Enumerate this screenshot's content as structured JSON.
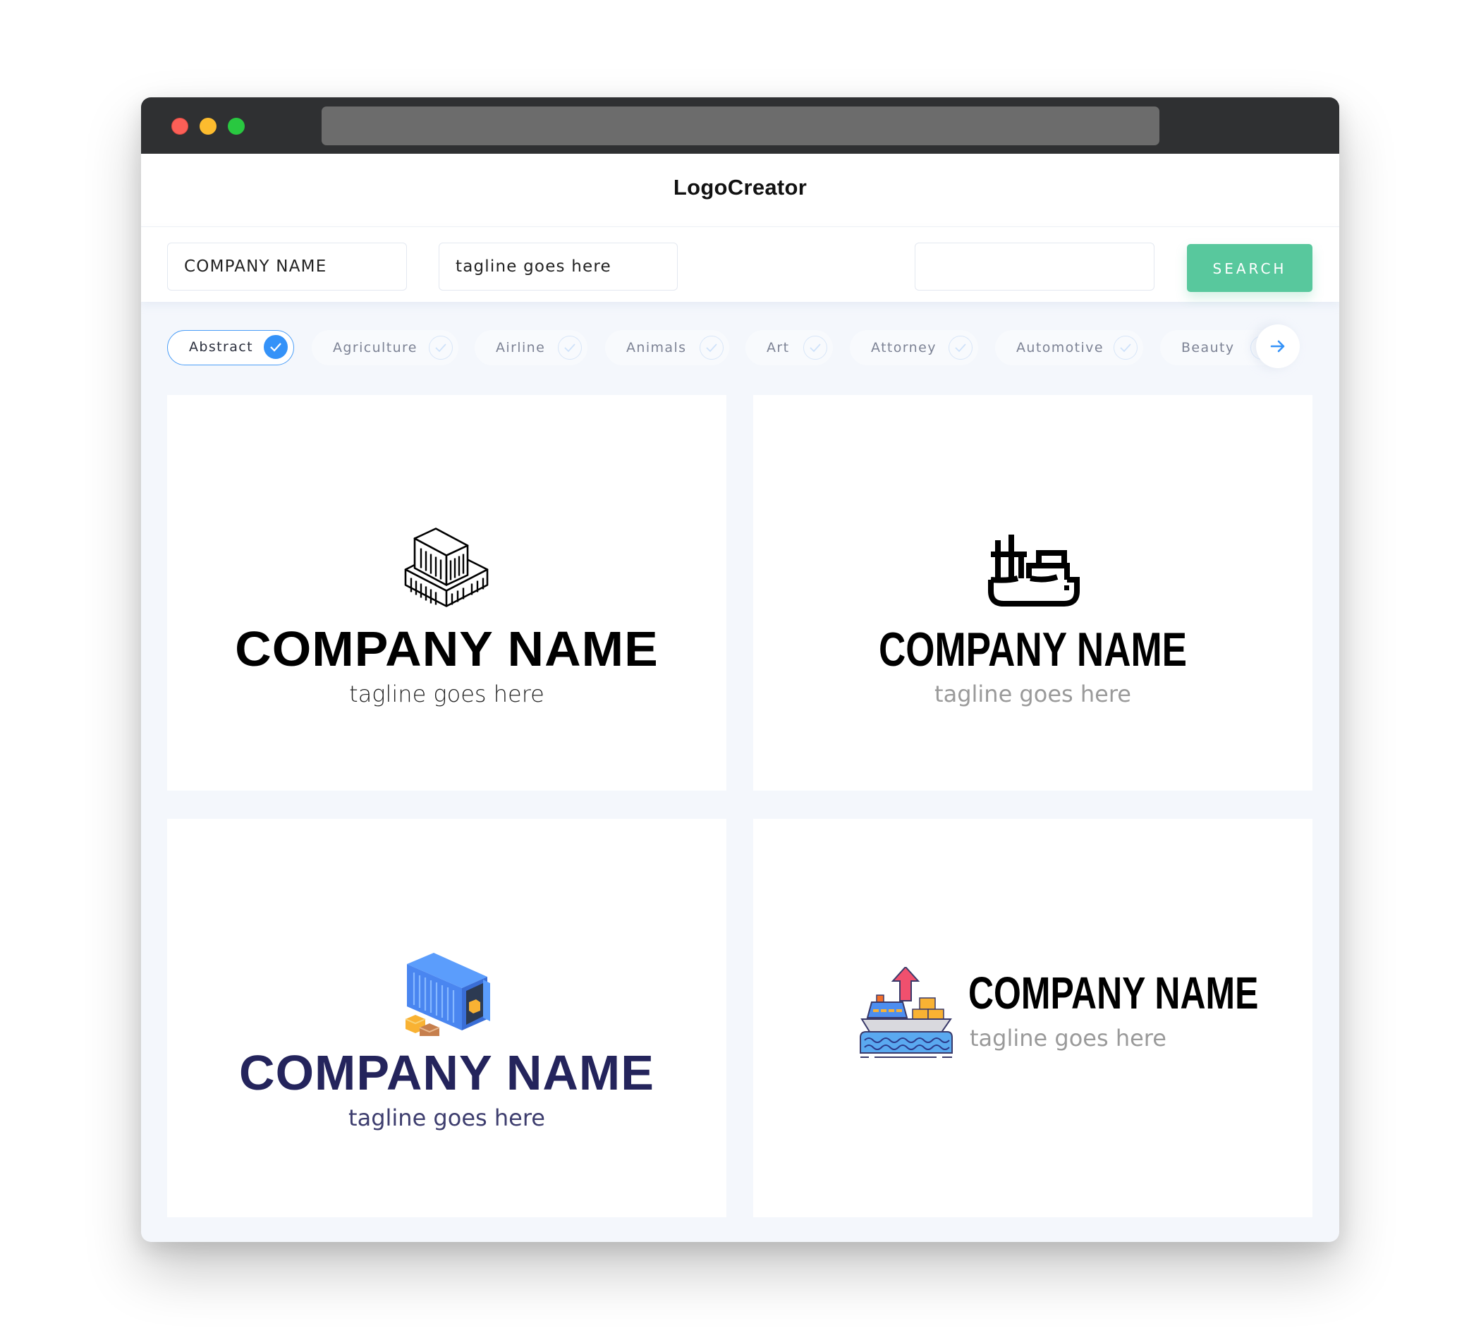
{
  "window": {
    "traffic_lights": [
      "close",
      "minimize",
      "maximize"
    ],
    "colors": {
      "close": "#fc5f57",
      "minimize": "#fdbc2e",
      "maximize": "#29c840",
      "titlebar": "#2f3032",
      "urlbar": "#6c6c6c"
    }
  },
  "header": {
    "brand": "LogoCreator"
  },
  "search": {
    "company_name_value": "COMPANY NAME",
    "tagline_value": "tagline goes here",
    "query_value": "",
    "button_label": "SEARCH",
    "button_color": "#58c89d"
  },
  "categories": {
    "items": [
      {
        "label": "Abstract",
        "selected": true
      },
      {
        "label": "Agriculture",
        "selected": false
      },
      {
        "label": "Airline",
        "selected": false
      },
      {
        "label": "Animals",
        "selected": false
      },
      {
        "label": "Art",
        "selected": false
      },
      {
        "label": "Attorney",
        "selected": false
      },
      {
        "label": "Automotive",
        "selected": false
      },
      {
        "label": "Beauty",
        "selected": false
      }
    ],
    "accent": "#3492f8",
    "next_icon": "arrow-right-icon"
  },
  "logos": [
    {
      "icon": "stacked-containers-icon",
      "name": "COMPANY NAME",
      "tagline": "tagline goes here",
      "name_color": "#000000",
      "tagline_color": "#222222"
    },
    {
      "icon": "cargo-ship-icon",
      "name": "COMPANY NAME",
      "tagline": "tagline goes here",
      "name_color": "#000000",
      "tagline_color": "#9a9a9a"
    },
    {
      "icon": "open-container-boxes-icon",
      "name": "COMPANY NAME",
      "tagline": "tagline goes here",
      "name_color": "#24245c",
      "tagline_color": "#3d3d6e"
    },
    {
      "icon": "export-ship-icon",
      "name": "COMPANY NAME",
      "tagline": "tagline goes here",
      "name_color": "#000000",
      "tagline_color": "#9a9a9a"
    }
  ]
}
